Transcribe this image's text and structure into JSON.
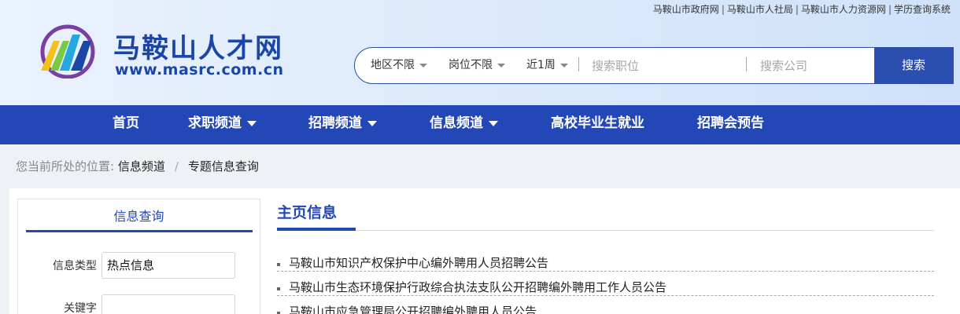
{
  "toplinks": [
    "马鞍山市政府网",
    "马鞍山市人社局",
    "马鞍山市人力资源网",
    "学历查询系统"
  ],
  "toplinks_sep": "|",
  "site": {
    "title": "马鞍山人才网",
    "url": "www.masrc.com.cn"
  },
  "search": {
    "region": "地区不限",
    "position": "岗位不限",
    "period": "近1周",
    "job_placeholder": "搜索职位",
    "company_placeholder": "搜索公司",
    "button": "搜索"
  },
  "nav": {
    "home": "首页",
    "job_seek": "求职频道",
    "recruit": "招聘频道",
    "info": "信息频道",
    "graduates": "高校毕业生就业",
    "job_fair": "招聘会预告"
  },
  "breadcrumb": {
    "prefix": "您当前所处的位置:",
    "level1": "信息频道",
    "sep": "/",
    "level2": "专题信息查询"
  },
  "sidebar": {
    "title": "信息查询",
    "type_label": "信息类型",
    "type_value": "热点信息",
    "keyword_label": "关键字",
    "keyword_value": ""
  },
  "main": {
    "title": "主页信息",
    "items": [
      "马鞍山市知识产权保护中心编外聘用人员招聘公告",
      "马鞍山市生态环境保护行政综合执法支队公开招聘编外聘用工作人员公告",
      "马鞍山市应急管理局公开招聘编外聘用人员公告"
    ]
  },
  "colors": {
    "brand": "#2447b8",
    "title": "#1b46a8",
    "button": "#2b4fb0"
  }
}
